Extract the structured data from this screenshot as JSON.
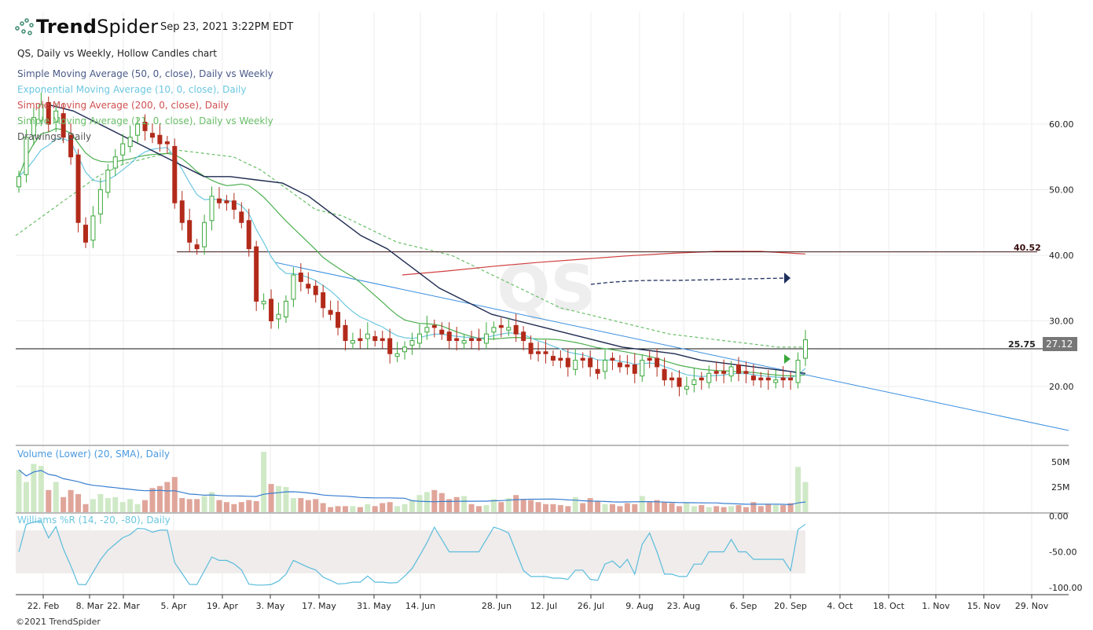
{
  "header": {
    "brand_bold": "Trend",
    "brand_light": "Spider",
    "timestamp": "Sep 23, 2021 3:22PM EDT"
  },
  "legend": {
    "title": "QS, Daily vs Weekly, Hollow Candles chart",
    "items": [
      {
        "label": "Simple Moving Average (50, 0, close), Daily vs Weekly",
        "color": "#2b3a6b"
      },
      {
        "label": "Exponential Moving Average (10, 0, close), Daily",
        "color": "#6cc7e0"
      },
      {
        "label": "Simple Moving Average (200, 0, close), Daily",
        "color": "#d04040"
      },
      {
        "label": "Simple Moving Average (21, 0, close), Daily vs Weekly",
        "color": "#6abf69"
      },
      {
        "label": "Drawings, Daily",
        "color": "#555555"
      }
    ]
  },
  "watermark": "QS",
  "footer": "©2021 TrendSpider",
  "chart_data": {
    "type": "candlestick",
    "symbol": "QS",
    "y_ticks": [
      "60.00",
      "50.00",
      "40.00",
      "30.00",
      "20.00"
    ],
    "y_tick_values": [
      60,
      50,
      40,
      30,
      20
    ],
    "ylim": [
      10,
      67
    ],
    "x_ticks": [
      "22. Feb",
      "8. Mar",
      "22. Mar",
      "5. Apr",
      "19. Apr",
      "3. May",
      "17. May",
      "31. May",
      "14. Jun",
      "28. Jun",
      "12. Jul",
      "26. Jul",
      "9. Aug",
      "23. Aug",
      "6. Sep",
      "20. Sep",
      "4. Oct",
      "18. Oct",
      "1. Nov",
      "15. Nov",
      "29. Nov"
    ],
    "last_price": "27.12",
    "levels": [
      {
        "label": "40.52",
        "value": 40.52
      },
      {
        "label": "25.75",
        "value": 25.75
      }
    ],
    "close": [
      52,
      58,
      61,
      63,
      60,
      62,
      58,
      55,
      45,
      42,
      46,
      50,
      53,
      55,
      57,
      58,
      60,
      59,
      58,
      57,
      57,
      48,
      45,
      42,
      41,
      45,
      49,
      48,
      48,
      47,
      45,
      41,
      33,
      33,
      30,
      31,
      33,
      37,
      36,
      35,
      34,
      32,
      31,
      29,
      27,
      27,
      27,
      28,
      27,
      27,
      25,
      25,
      26,
      27,
      28,
      29,
      29,
      28,
      27,
      27,
      27,
      27,
      27,
      28,
      29,
      29,
      29,
      28,
      27,
      25,
      25,
      25,
      24,
      24,
      23,
      24,
      24,
      23,
      22,
      24,
      24,
      23,
      23,
      22,
      24,
      24,
      23,
      21,
      21,
      20,
      20,
      21,
      21,
      22,
      22,
      22,
      23,
      22,
      22,
      21,
      21,
      21,
      21,
      21,
      21,
      24,
      27.12
    ],
    "sma50": [
      63,
      62,
      60,
      58,
      56,
      54,
      52,
      52,
      51.5,
      51,
      49,
      46,
      43,
      41,
      38,
      35,
      33,
      31,
      30,
      29,
      28,
      27,
      26,
      25.5,
      25,
      24,
      23.5,
      23,
      22.5,
      22
    ],
    "sma21_weekly": [
      43,
      46,
      49,
      52,
      54,
      55,
      56,
      55.5,
      55,
      53,
      50,
      47,
      46,
      44,
      42,
      41,
      40,
      38,
      36,
      34,
      32,
      31,
      30,
      29,
      28,
      27.5,
      27,
      26.5,
      26,
      26
    ],
    "sma200": [
      37,
      37.6,
      38.3,
      38.9,
      39.4,
      39.9,
      40.3,
      40.6,
      40.6,
      40.2
    ],
    "volume_ylim": [
      0,
      65
    ],
    "volume_ticks": [
      "50M",
      "25M"
    ],
    "volume_m": [
      42,
      30,
      48,
      46,
      22,
      30,
      15,
      22,
      18,
      8,
      13,
      18,
      14,
      15,
      10,
      13,
      8,
      12,
      24,
      26,
      30,
      35,
      14,
      13,
      13,
      16,
      20,
      12,
      10,
      8,
      10,
      12,
      11,
      60,
      28,
      26,
      25,
      14,
      14,
      12,
      13,
      9,
      5,
      6,
      6,
      6,
      5,
      8,
      6,
      9,
      10,
      6,
      8,
      12,
      17,
      20,
      22,
      19,
      13,
      15,
      16,
      8,
      6,
      7,
      13,
      10,
      14,
      17,
      13,
      12,
      10,
      8,
      8,
      7,
      6,
      15,
      9,
      14,
      11,
      8,
      8,
      6,
      9,
      8,
      16,
      10,
      12,
      10,
      9,
      6,
      9,
      6,
      7,
      5,
      6,
      5,
      6,
      7,
      5,
      10,
      6,
      8,
      7,
      7,
      9,
      45,
      30
    ],
    "wr_ticks": [
      "0.00",
      "-50.00",
      "-100.00"
    ],
    "wr_ylim": [
      -100,
      0
    ],
    "wr_band": [
      -80,
      -20
    ]
  }
}
